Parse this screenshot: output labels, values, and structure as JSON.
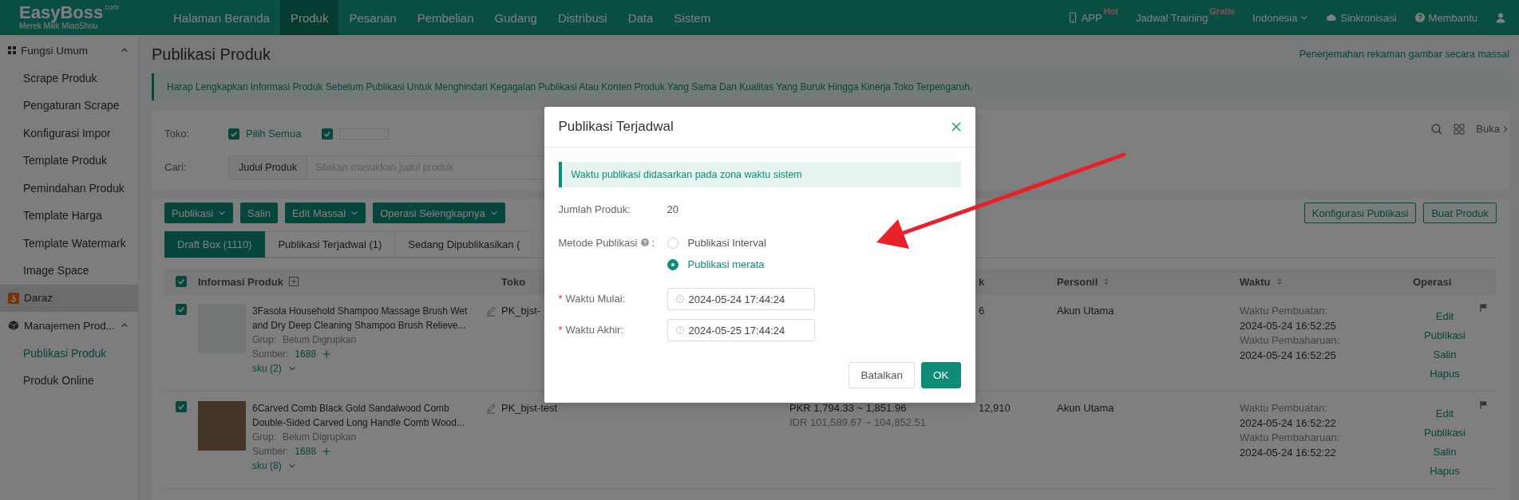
{
  "top_bar": {
    "logo": {
      "name": "EasyBoss",
      "suffix": ".com",
      "tagline": "Merek Milik MiaoShou"
    },
    "nav": [
      {
        "label": "Halaman Beranda",
        "selected": false
      },
      {
        "label": "Produk",
        "selected": true
      },
      {
        "label": "Pesanan",
        "selected": false
      },
      {
        "label": "Pembelian",
        "selected": false
      },
      {
        "label": "Gudang",
        "selected": false
      },
      {
        "label": "Distribusi",
        "selected": false
      },
      {
        "label": "Data",
        "selected": false
      },
      {
        "label": "Sistem",
        "selected": false
      }
    ],
    "actions": [
      {
        "kind": "app",
        "label": "APP",
        "badge": "Hot"
      },
      {
        "kind": "training",
        "label": "Jadwal Training",
        "badge": "Gratis"
      },
      {
        "kind": "language",
        "label": "Indonesia"
      },
      {
        "kind": "sync",
        "label": "Sinkronisasi"
      },
      {
        "kind": "help",
        "label": "Membantu"
      },
      {
        "kind": "user"
      }
    ]
  },
  "sidebar": {
    "groups": [
      {
        "label": "Fungsi Umum",
        "kind": "grid",
        "highlighted": false,
        "expanded": true,
        "children": [
          {
            "label": "Scrape Produk",
            "selected": false
          },
          {
            "label": "Pengaturan Scrape",
            "selected": false
          },
          {
            "label": "Konfigurasi Impor",
            "selected": false
          },
          {
            "label": "Template Produk",
            "selected": false
          },
          {
            "label": "Pemindahan Produk",
            "selected": false
          },
          {
            "label": "Template Harga",
            "selected": false
          },
          {
            "label": "Template Watermark",
            "selected": false
          },
          {
            "label": "Image Space",
            "selected": false
          }
        ]
      },
      {
        "label": "Daraz",
        "kind": "daraz",
        "highlighted": true
      },
      {
        "label": "Manajemen Prod...",
        "kind": "cube",
        "highlighted": false,
        "expanded": true,
        "children": [
          {
            "label": "Publikasi Produk",
            "selected": true
          },
          {
            "label": "Produk Online",
            "selected": false
          }
        ]
      }
    ]
  },
  "page": {
    "title": "Publikasi Produk",
    "link": "Penerjemahan rekaman gambar secara massal",
    "notice": "Harap Lengkapkan Informasi Produk Sebelum Publikasi Untuk Menghindari Kegagalan Publikasi Atau Konten Produk Yang Sama Dan Kualitas Yang Buruk Hingga Kinerja Toko Terpengaruh."
  },
  "filters": {
    "shop_label": "Toko:",
    "shops": [
      {
        "kind": "text",
        "label": "Pilih Semua",
        "checked": true
      },
      {
        "kind": "redacted",
        "checked": true
      }
    ],
    "search_label": "Cari:",
    "search_field": "Judul Produk",
    "placeholder": "Silakan masukkan judul produk",
    "expand_link": "Buka"
  },
  "toolbar": {
    "left": [
      {
        "label": "Publikasi",
        "dropdown": true
      },
      {
        "label": "Salin",
        "dropdown": false
      },
      {
        "label": "Edit Massal",
        "dropdown": true
      },
      {
        "label": "Operasi Selengkapnya",
        "dropdown": true
      }
    ],
    "right": [
      "Konfigurasi Publikasi",
      "Buat Produk"
    ]
  },
  "table": {
    "tabs": [
      {
        "label": "Draft Box (1110)",
        "selected": true
      },
      {
        "label": "Publikasi Terjadwal (1)",
        "selected": false
      },
      {
        "label": "Sedang Dipublikasikan (",
        "selected": false
      }
    ],
    "all_checked": true,
    "columns": [
      {
        "label": "Informasi Produk",
        "kind": "expandable"
      },
      {
        "label": "Toko",
        "kind": "plain"
      },
      {
        "label": "k",
        "kind": "plain"
      },
      {
        "label": "Personil",
        "kind": "sortable"
      },
      {
        "label": "Waktu",
        "kind": "sortable"
      },
      {
        "label": "Operasi",
        "kind": "plain"
      }
    ],
    "rows": [
      {
        "checked": true,
        "title": "3Fasola Household Shampoo Massage Brush Wet and Dry Deep Cleaning Shampoo Brush Relieve...",
        "group_label": "Grup:",
        "group": "Belum Digrupkan",
        "source_label": "Sumber:",
        "source": "1688",
        "sku": "sku (2)",
        "shop": "PK_bjst-",
        "stock": "6",
        "personnel": "Akun Utama",
        "times": [
          {
            "label": "Waktu Pembuatan:",
            "value": "2024-05-24 16:52:25"
          },
          {
            "label": "Waktu Pembaharuan:",
            "value": "2024-05-24 16:52:25"
          }
        ],
        "actions": [
          "Edit",
          "Publikasi",
          "Salin",
          "Hapus"
        ]
      },
      {
        "checked": true,
        "title": "6Carved Comb Black Gold Sandalwood Comb Double-Sided Carved Long Handle Comb Wood...",
        "group_label": "Grup:",
        "group": "Belum Digrupkan",
        "source_label": "Sumber:",
        "source": "1688",
        "sku": "sku (8)",
        "shop": "PK_bjst-test",
        "prices": [
          "PKR 1,794.33 ~ 1,851.96",
          "IDR 101,589.67 ~ 104,852.51"
        ],
        "stock": "12,910",
        "personnel": "Akun Utama",
        "times": [
          {
            "label": "Waktu Pembuatan:",
            "value": "2024-05-24 16:52:22"
          },
          {
            "label": "Waktu Pembaharuan:",
            "value": "2024-05-24 16:52:22"
          }
        ],
        "actions": [
          "Edit",
          "Publikasi",
          "Salin",
          "Hapus"
        ]
      }
    ]
  },
  "modal": {
    "title": "Publikasi Terjadwal",
    "notice": "Waktu publikasi didasarkan pada zona waktu sistem",
    "fields": [
      {
        "kind": "text",
        "label": "Jumlah Produk:",
        "value": "20"
      },
      {
        "kind": "radio",
        "label": "Metode Publikasi",
        "suffix": ":",
        "options": [
          {
            "label": "Publikasi Interval",
            "selected": false
          },
          {
            "label": "Publikasi merata",
            "selected": true
          }
        ]
      },
      {
        "kind": "datetime",
        "label": "Waktu Mulai:",
        "required_mark": "*",
        "value": "2024-05-24 17:44:24"
      },
      {
        "kind": "datetime",
        "label": "Waktu Akhir:",
        "required_mark": "*",
        "value": "2024-05-25 17:44:24"
      }
    ],
    "buttons": [
      {
        "label": "Batalkan",
        "kind": "secondary"
      },
      {
        "label": "OK",
        "kind": "primary"
      }
    ]
  }
}
